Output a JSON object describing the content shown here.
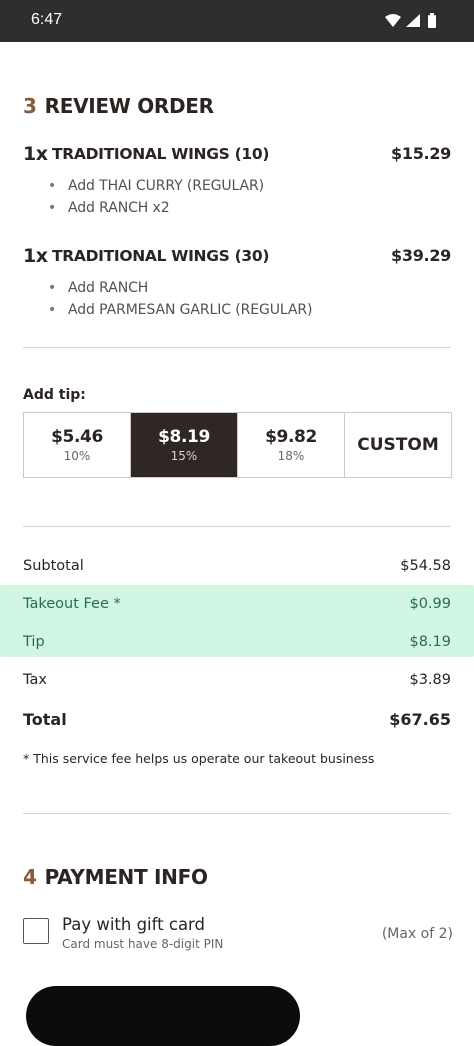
{
  "status_bar": {
    "time": "6:47"
  },
  "review": {
    "step": "3",
    "title": "REVIEW ORDER",
    "items": [
      {
        "qty": "1x",
        "name": "TRADITIONAL WINGS (10)",
        "price": "$15.29",
        "mods": [
          "Add THAI CURRY (REGULAR)",
          "Add RANCH x2"
        ]
      },
      {
        "qty": "1x",
        "name": "TRADITIONAL WINGS (30)",
        "price": "$39.29",
        "mods": [
          "Add RANCH",
          "Add PARMESAN GARLIC (REGULAR)"
        ]
      }
    ]
  },
  "tip": {
    "label": "Add tip:",
    "options": [
      {
        "amount": "$5.46",
        "percent": "10%"
      },
      {
        "amount": "$8.19",
        "percent": "15%",
        "selected": true
      },
      {
        "amount": "$9.82",
        "percent": "18%"
      }
    ],
    "custom_label": "CUSTOM"
  },
  "summary": {
    "subtotal_label": "Subtotal",
    "subtotal": "$54.58",
    "takeout_fee_label": "Takeout Fee *",
    "takeout_fee": "$0.99",
    "tip_label": "Tip",
    "tip": "$8.19",
    "tax_label": "Tax",
    "tax": "$3.89",
    "total_label": "Total",
    "total": "$67.65",
    "footnote": "* This service fee helps us operate our takeout business"
  },
  "payment": {
    "step": "4",
    "title": "PAYMENT INFO",
    "gift_card_label": "Pay with gift card",
    "gift_card_sub": "Card must have 8-digit PIN",
    "gift_card_max": "(Max of 2)"
  },
  "colors": {
    "accent_number": "#8a5a3a",
    "selected_tip_bg": "#2e2725",
    "highlight": "#c9f5df",
    "status_bar": "#2e2e30"
  }
}
